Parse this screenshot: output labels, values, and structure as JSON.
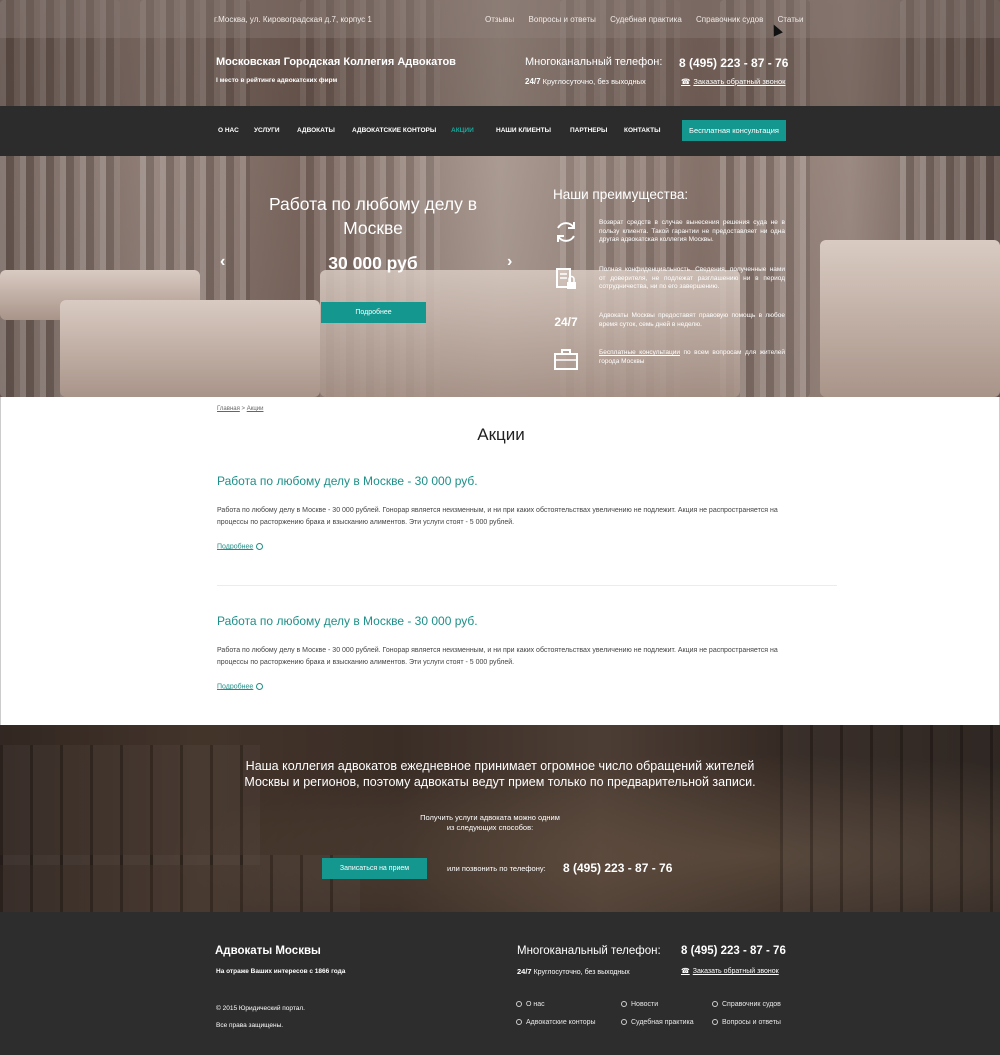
{
  "topbar": {
    "address": "г.Москва, ул. Кировоградская д.7, корпус 1",
    "links": [
      "Отзывы",
      "Вопросы и ответы",
      "Судебная практика",
      "Справочник судов",
      "Статьи"
    ]
  },
  "header": {
    "brand": "Московская Городская Коллегия Адвокатов",
    "brand_sub": "I место в рейтинге адвокатских фирм",
    "phone_label": "Многоканальный телефон:",
    "phone_number": "8 (495) 223 - 87 - 76",
    "hours_bold": "24/7",
    "hours_text": "Круглосуточно, без выходных",
    "callback": "Заказать обратный звонок"
  },
  "nav": {
    "items": [
      "О нас",
      "Услуги",
      "Адвокаты",
      "Адвокатские конторы",
      "Акции",
      "Наши клиенты",
      "Партнеры",
      "Контакты"
    ],
    "active": "Акции",
    "cta": "Бесплатная консультация"
  },
  "banner": {
    "title": "Работа по любому делу в Москве",
    "price": "30 000 руб",
    "button": "Подробнее",
    "prev_icon": "chevron-left-icon",
    "next_icon": "chevron-right-icon"
  },
  "advantages": {
    "title": "Наши преимущества:",
    "items": [
      {
        "icon": "refresh-icon",
        "text": "Возврат средств в случае вынесения решения суда не в пользу клиента. Такой гарантии не предоставляет ни одна другая адвокатская коллегия Москвы."
      },
      {
        "icon": "document-lock-icon",
        "text": "Полная конфиденциальность. Сведения, полученные нами от доверителя, не подлежат разглашению ни в период сотрудничества, ни по его завершению."
      },
      {
        "icon": "24-7-icon",
        "icon_text": "24/7",
        "text": "Адвокаты Москвы предоставят правовую помощь в любое время суток, семь дней в неделю."
      },
      {
        "icon": "briefcase-icon",
        "link": "Бесплатные консультации",
        "text": "по всем вопросам для жителей города Москвы"
      }
    ]
  },
  "content": {
    "breadcrumb_home": "Главная",
    "breadcrumb_sep": ">",
    "breadcrumb_current": "Акции",
    "title": "Акции",
    "promos": [
      {
        "title": "Работа по любому делу в Москве - 30 000 руб.",
        "text": "Работа по любому делу в Москве - 30 000 рублей. Гонорар является неизменным, и ни при каких обстоятельствах увеличению не подлежит. Акция не распространяется на процессы по расторжению брака и взысканию алиментов. Эти услуги стоят - 5 000 рублей.",
        "more": "Подробнее"
      },
      {
        "title": "Работа по любому делу в Москве - 30 000 руб.",
        "text": "Работа по любому делу в Москве - 30 000 рублей. Гонорар является неизменным, и ни при каких обстоятельствах увеличению не подлежит. Акция не распространяется на процессы по расторжению брака и взысканию алиментов. Эти услуги стоят - 5 000 рублей.",
        "more": "Подробнее"
      }
    ]
  },
  "books_banner": {
    "line1": "Наша коллегия адвокатов ежедневное принимает огромное число обращений жителей",
    "line2": "Москвы и регионов, поэтому адвокаты ведут прием только по предварительной записи.",
    "get_line1": "Получить услуги адвоката можно одним",
    "get_line2": "из следующих способов:",
    "signup": "Записаться на прием",
    "or_call": "или позвонить по телефону:",
    "phone": "8 (495) 223 - 87 - 76"
  },
  "footer": {
    "title": "Адвокаты Москвы",
    "since": "На отраже Ваших интересов с 1866 года",
    "copyright": "© 2015  Юридический портал.",
    "rights": "Все права защищены.",
    "phone_label": "Многоканальный телефон:",
    "phone_number": "8 (495) 223 - 87 - 76",
    "hours_bold": "24/7",
    "hours_text": "Круглосуточно, без выходных",
    "callback": "Заказать обратный звонок",
    "links": [
      "О нас",
      "Новости",
      "Справочник судов",
      "Адвокатские конторы",
      "Судебная практика",
      "Вопросы и ответы"
    ]
  },
  "colors": {
    "accent": "#13978f",
    "link": "#1e8f88",
    "nav_bg": "#2c2c2c",
    "footer_bg": "#2d2d2d"
  }
}
